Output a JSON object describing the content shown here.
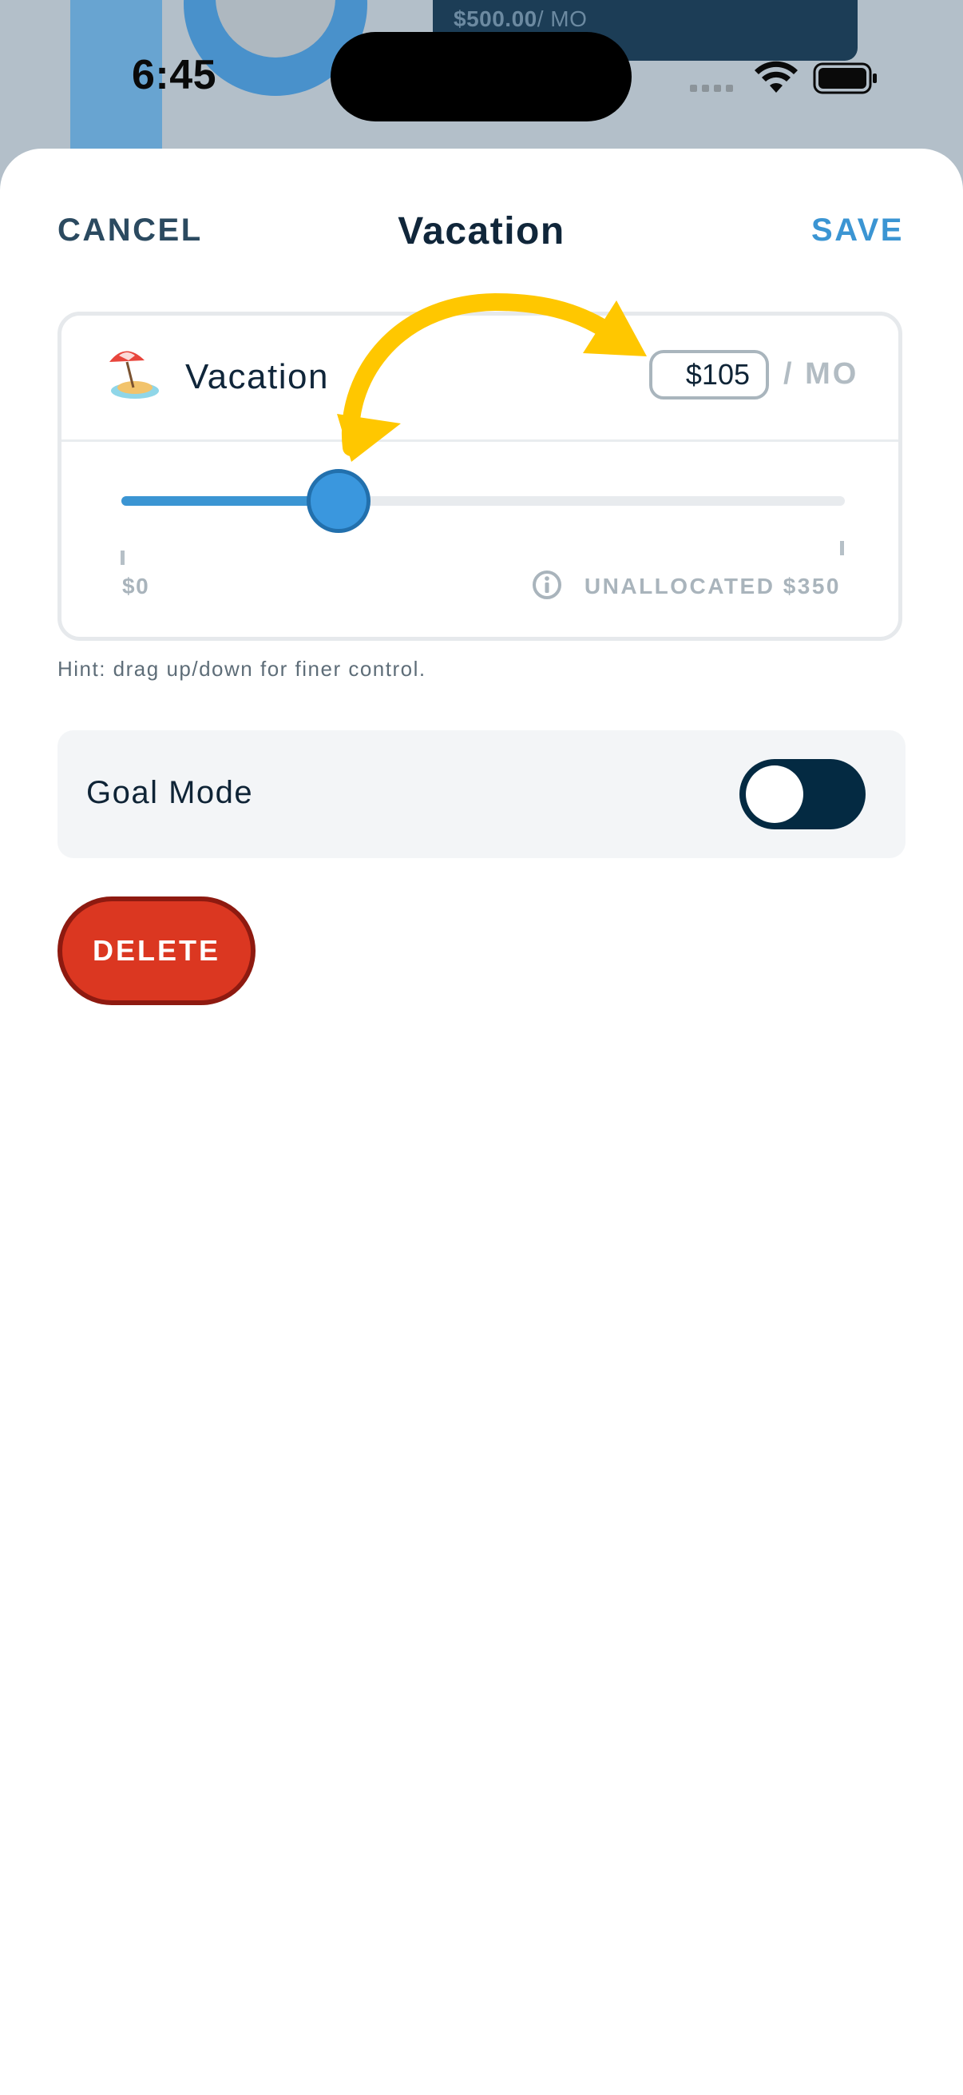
{
  "backdrop": {
    "card_amount": "$500.00",
    "card_unit": "/ MO"
  },
  "status_bar": {
    "time": "6:45"
  },
  "nav": {
    "cancel_label": "CANCEL",
    "title": "Vacation",
    "save_label": "SAVE"
  },
  "budget": {
    "emoji_icon": "beach-with-umbrella-icon",
    "name": "Vacation",
    "amount": "$105",
    "unit": "/ MO",
    "slider_value": 105,
    "slider_max": 350,
    "min_label": "$0",
    "unallocated_label": "UNALLOCATED $350"
  },
  "hint": "Hint: drag up/down for finer control.",
  "goal_mode": {
    "label": "Goal Mode",
    "enabled": true
  },
  "delete_label": "DELETE",
  "colors": {
    "accent": "#3b95d3",
    "navy": "#042a42",
    "danger": "#db3721",
    "annotation": "#ffc700"
  }
}
